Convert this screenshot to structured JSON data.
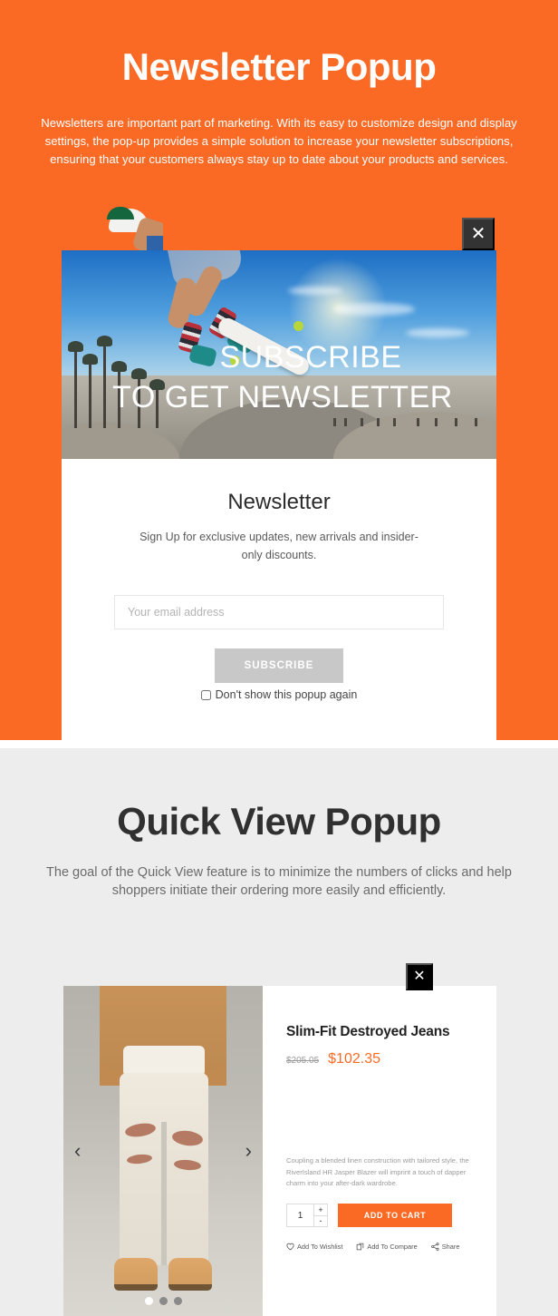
{
  "colors": {
    "orange": "#fa6a25",
    "gray_section": "#ededed",
    "subscribe_button": "#c8c8c8",
    "dark_close": "#333333",
    "black_close": "#000000"
  },
  "newsletter_section": {
    "title": "Newsletter Popup",
    "description": "Newsletters are important part of marketing. With its easy to customize design and display settings, the pop-up provides a simple solution to increase your newsletter subscriptions, ensuring that your customers always stay up to date about your products and services.",
    "popup": {
      "close_label": "✕",
      "hero_overlay_line1": "SUBSCRIBE",
      "hero_overlay_line2": "TO GET NEWSLETTER",
      "form_title": "Newsletter",
      "form_subtitle": "Sign Up for exclusive updates, new arrivals and insider-only discounts.",
      "email_placeholder": "Your email address",
      "email_value": "",
      "subscribe_label": "SUBSCRIBE",
      "dont_show_label": "Don't show this popup again"
    }
  },
  "quickview_section": {
    "title": "Quick View Popup",
    "description": "The goal of the Quick View feature is to minimize the numbers of clicks and help shoppers initiate their ordering more easily and efficiently.",
    "popup": {
      "close_label": "✕",
      "prev_arrow": "‹",
      "next_arrow": "›",
      "slide_count": 3,
      "active_slide": 1,
      "product_name": "Slim-Fit Destroyed Jeans",
      "old_price": "$205.05",
      "new_price": "$102.35",
      "short_description": "Coupling a blended linen construction with tailored style, the RiverIsland HR Jasper Blazer will imprint a touch of dapper charm into your after-dark wardrobe.",
      "quantity_value": "1",
      "qty_increase": "+",
      "qty_decrease": "-",
      "add_to_cart_label": "ADD TO CART",
      "actions": [
        {
          "label": "Add To Wishlist",
          "icon": "heart-icon"
        },
        {
          "label": "Add To Compare",
          "icon": "compare-icon"
        },
        {
          "label": "Share",
          "icon": "share-icon"
        }
      ]
    }
  }
}
